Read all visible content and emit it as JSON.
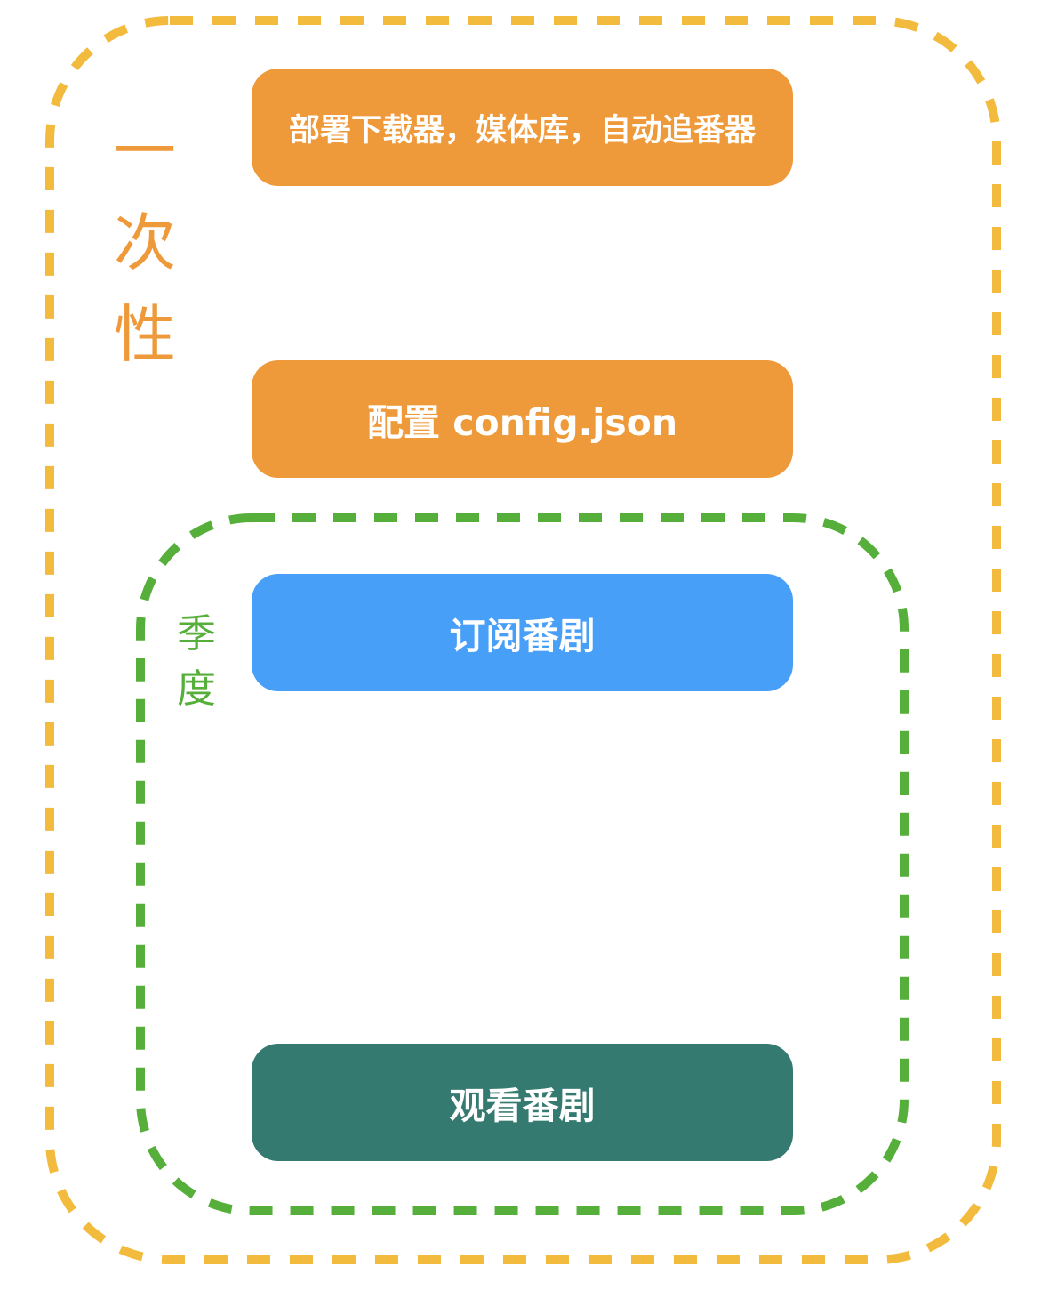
{
  "colors": {
    "outer_border": "#F2BB3D",
    "inner_border": "#55AF3A",
    "onetime_label": "#EF9A3A",
    "season_label": "#55AF3A",
    "step_orange": "#EF9A3A",
    "step_blue": "#489FF8",
    "step_teal": "#357A70",
    "step_text": "#FFFFFF"
  },
  "groups": {
    "onetime": {
      "label_chars": [
        "一",
        "次",
        "性"
      ]
    },
    "season": {
      "label_chars": [
        "季",
        "度"
      ]
    }
  },
  "steps": [
    {
      "label": "部署下载器，媒体库，自动追番器",
      "color_key": "step_orange"
    },
    {
      "label": "配置 config.json",
      "color_key": "step_orange"
    },
    {
      "label": "订阅番剧",
      "color_key": "step_blue"
    },
    {
      "label": "观看番剧",
      "color_key": "step_teal"
    }
  ]
}
